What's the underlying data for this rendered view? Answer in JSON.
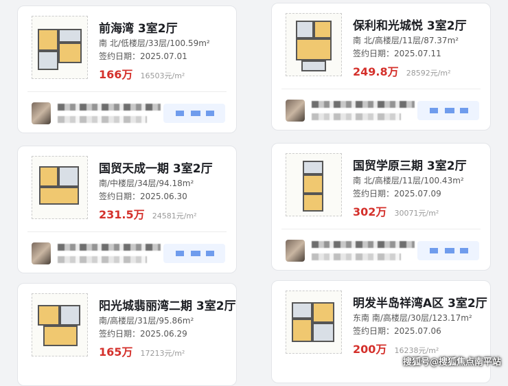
{
  "listings": [
    {
      "title": "前海湾 3室2厅",
      "meta": "南 北/低楼层/33层/100.59m²",
      "date": "签约日期：2025.07.01",
      "price": "166万",
      "unit_price": "16503元/m²"
    },
    {
      "title": "保利和光城悦 3室2厅",
      "meta": "南 北/高楼层/11层/87.37m²",
      "date": "签约日期：2025.07.11",
      "price": "249.8万",
      "unit_price": "28592元/m²"
    },
    {
      "title": "国贸天成一期 3室2厅",
      "meta": "南/中楼层/34层/94.18m²",
      "date": "签约日期：2025.06.30",
      "price": "231.5万",
      "unit_price": "24581元/m²"
    },
    {
      "title": "国贸学原三期 3室2厅",
      "meta": "南 北/高楼层/11层/100.43m²",
      "date": "签约日期：2025.07.09",
      "price": "302万",
      "unit_price": "30071元/m²"
    },
    {
      "title": "阳光城翡丽湾二期 3室2厅",
      "meta": "南/高楼层/31层/95.86m²",
      "date": "签约日期：2025.06.29",
      "price": "165万",
      "unit_price": "17213元/m²"
    },
    {
      "title": "明发半岛祥湾A区 3室2厅",
      "meta": "东南 南/高楼层/30层/123.17m²",
      "date": "签约日期：2025.07.06",
      "price": "200万",
      "unit_price": "16238元/m²"
    }
  ],
  "watermark": "搜狐号@搜狐焦点南平站"
}
